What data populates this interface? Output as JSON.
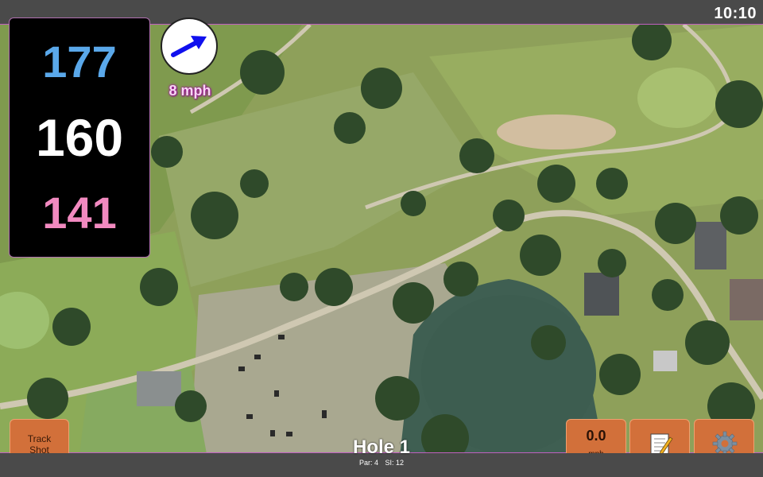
{
  "status": {
    "time": "10:10"
  },
  "yardage": {
    "back": "177",
    "middle": "160",
    "front": "141"
  },
  "wind": {
    "speed": "8 mph",
    "icon": "wind-direction-arrow-icon"
  },
  "buttons": {
    "track_shot_line1": "Track",
    "track_shot_line2": "Shot",
    "speed_value": "0.0",
    "speed_unit": "mph",
    "notes_icon": "notepad-icon",
    "settings_icon": "gear-icon"
  },
  "hole": {
    "title": "Hole 1",
    "par": "Par: 4",
    "si": "SI: 12"
  },
  "colors": {
    "back": "#5aa8ea",
    "middle": "#ffffff",
    "front": "#f28ac0",
    "button": "#d2703a",
    "wind_arrow": "#1010ee",
    "wind_label": "#a0189a"
  }
}
